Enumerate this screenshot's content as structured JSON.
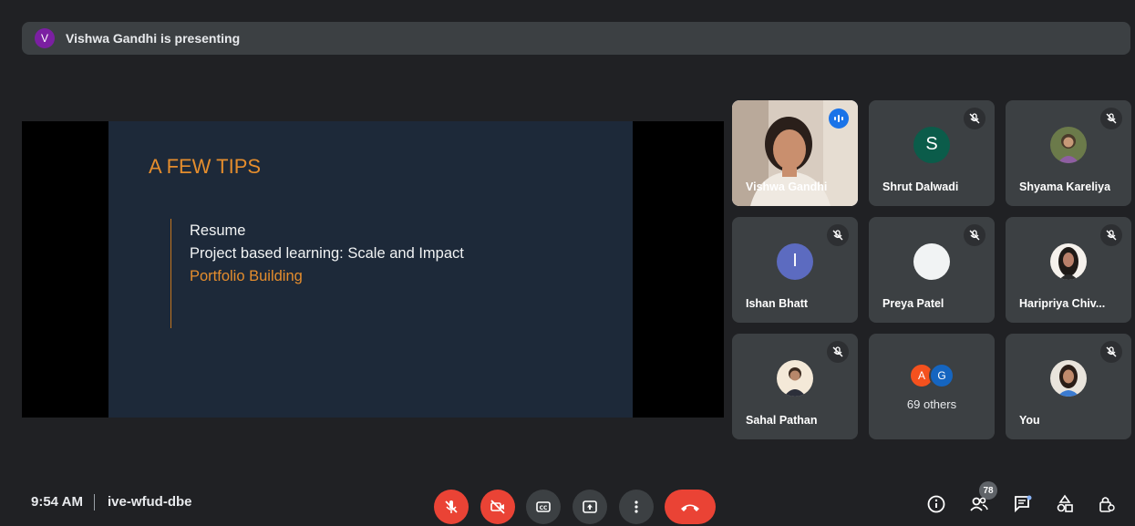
{
  "header": {
    "presenter_initial": "V",
    "presenting_text": "Vishwa Gandhi is presenting"
  },
  "slide": {
    "title": "A FEW TIPS",
    "items": [
      "Resume",
      "Project based learning: Scale and Impact",
      "Portfolio Building"
    ]
  },
  "participants": [
    {
      "name": "Vishwa Gandhi",
      "type": "video",
      "speaking": true
    },
    {
      "name": "Shrut Dalwadi",
      "type": "letter",
      "initial": "S",
      "color": "#0b5c4a",
      "muted": true
    },
    {
      "name": "Shyama Kareliya",
      "type": "photo",
      "muted": true
    },
    {
      "name": "Ishan Bhatt",
      "type": "letter",
      "initial": "I",
      "color": "#5c6bc0",
      "muted": true
    },
    {
      "name": "Preya Patel",
      "type": "blank",
      "muted": true
    },
    {
      "name": "Haripriya Chiv...",
      "type": "photo",
      "muted": true
    },
    {
      "name": "Sahal Pathan",
      "type": "photo",
      "muted": true
    },
    {
      "name": "You",
      "type": "photo",
      "muted": false
    }
  ],
  "others": {
    "initials": [
      "A",
      "G"
    ],
    "colors": [
      "#f4511e",
      "#1565c0"
    ],
    "label": "69 others"
  },
  "footer": {
    "time": "9:54 AM",
    "meeting_code": "ive-wfud-dbe",
    "people_count": "78"
  },
  "colors": {
    "accent": "#8ab4f8",
    "danger": "#ea4335",
    "surface": "#3c4043",
    "slide_orange": "#e58d2d"
  }
}
